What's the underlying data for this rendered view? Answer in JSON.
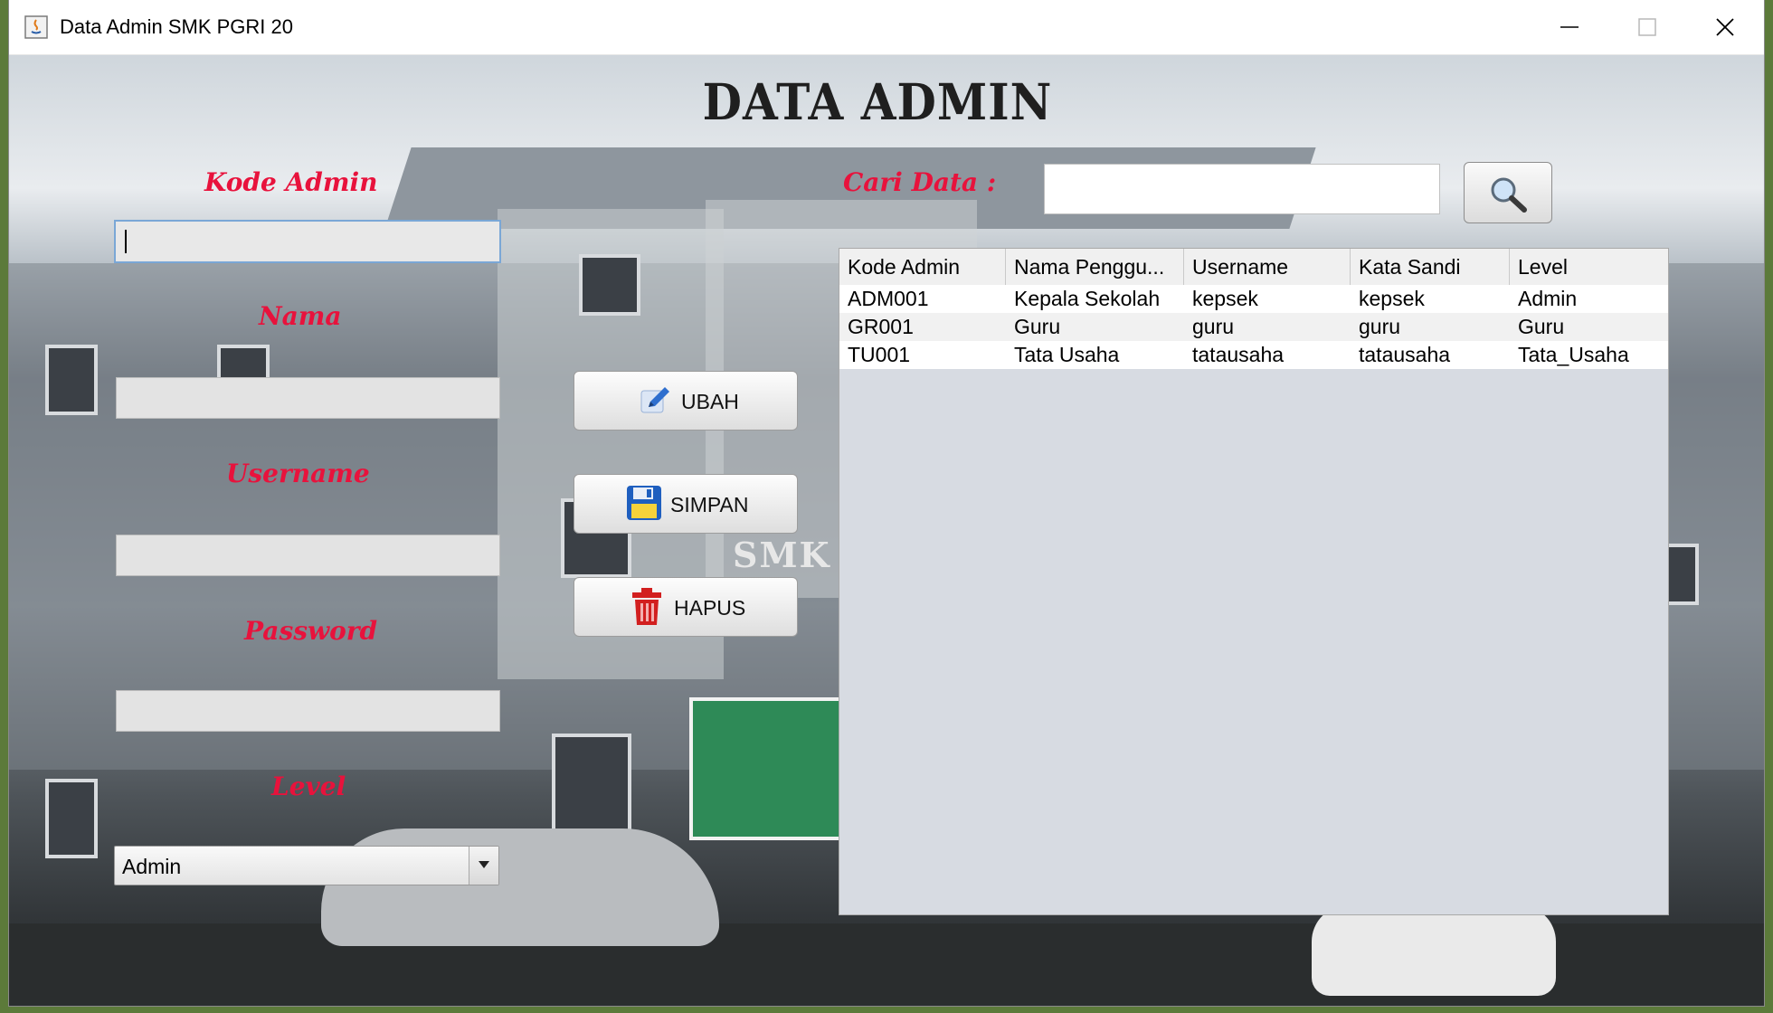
{
  "window": {
    "title": "Data Admin SMK PGRI 20"
  },
  "heading": "DATA ADMIN",
  "form": {
    "kode_admin_label": "Kode Admin",
    "nama_label": "Nama",
    "username_label": "Username",
    "password_label": "Password",
    "level_label": "Level",
    "kode_admin_value": "",
    "nama_value": "",
    "username_value": "",
    "password_value": "",
    "level_selected": "Admin"
  },
  "search": {
    "label": "Cari Data :",
    "value": "",
    "button_icon": "magnifier-icon"
  },
  "buttons": {
    "ubah": "UBAH",
    "simpan": "SIMPAN",
    "hapus": "HAPUS"
  },
  "background": {
    "sign_text": "SMK"
  },
  "table": {
    "columns": [
      "Kode Admin",
      "Nama Penggu...",
      "Username",
      "Kata Sandi",
      "Level"
    ],
    "rows": [
      [
        "ADM001",
        "Kepala Sekolah",
        "kepsek",
        "kepsek",
        "Admin"
      ],
      [
        "GR001",
        "Guru",
        "guru",
        "guru",
        "Guru"
      ],
      [
        "TU001",
        "Tata Usaha",
        "tatausaha",
        "tatausaha",
        "Tata_Usaha"
      ]
    ]
  },
  "colors": {
    "label_red": "#e8123c",
    "pencil_blue": "#2f6fce",
    "disk_blue": "#1f5fbf",
    "trash_red": "#d21f1f"
  }
}
